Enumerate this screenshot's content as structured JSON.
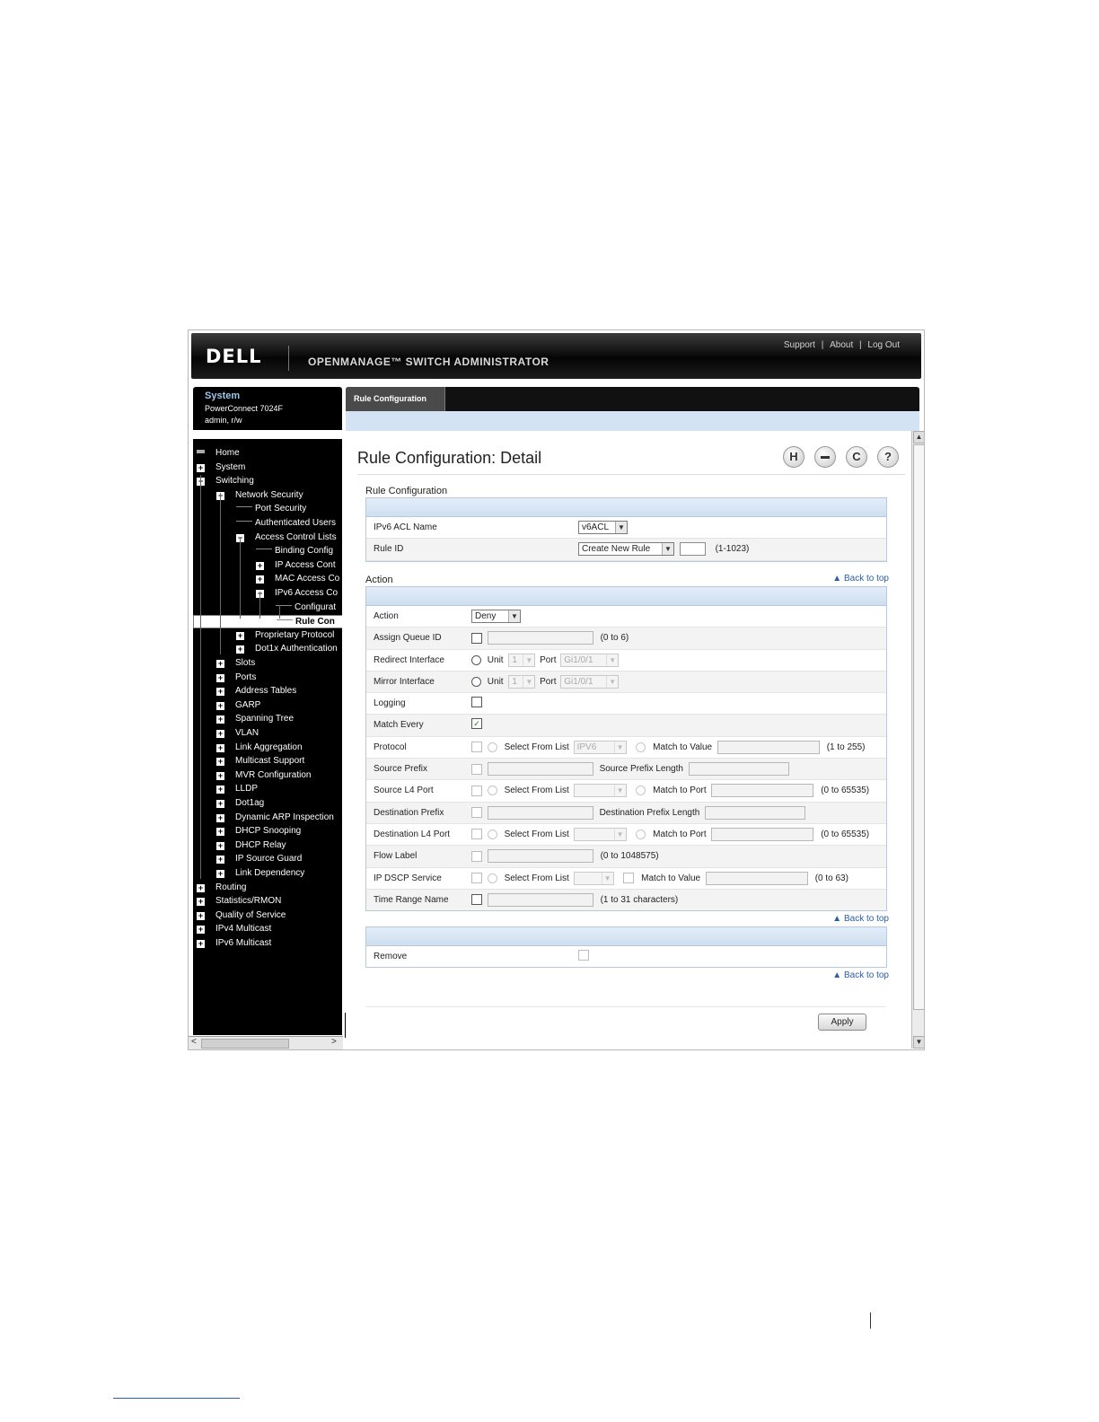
{
  "header": {
    "logo": "DELL",
    "product": "OPENMANAGE™ SWITCH ADMINISTRATOR",
    "links": [
      "Support",
      "About",
      "Log Out"
    ],
    "separator": "|"
  },
  "system_panel": {
    "title": "System",
    "model": "PowerConnect 7024F",
    "user": "admin, r/w"
  },
  "nav": {
    "items": [
      {
        "label": "Home",
        "icon": "home-icon"
      },
      {
        "label": "System",
        "icon": "expand-icon"
      },
      {
        "label": "Switching",
        "icon": "collapse-icon"
      },
      {
        "label": "Network Security",
        "icon": "collapse-icon"
      },
      {
        "label": "Port Security",
        "icon": "tree-leaf"
      },
      {
        "label": "Authenticated Users",
        "icon": "tree-leaf"
      },
      {
        "label": "Access Control Lists",
        "icon": "collapse-icon"
      },
      {
        "label": "Binding Config",
        "icon": "tree-leaf"
      },
      {
        "label": "IP Access Cont",
        "icon": "expand-icon"
      },
      {
        "label": "MAC Access Co",
        "icon": "expand-icon"
      },
      {
        "label": "IPv6 Access Co",
        "icon": "collapse-icon"
      },
      {
        "label": "Configurat",
        "icon": "tree-leaf"
      },
      {
        "label": "Rule Con",
        "icon": "tree-leaf",
        "selected": true
      },
      {
        "label": "Proprietary Protocol",
        "icon": "expand-icon"
      },
      {
        "label": "Dot1x Authentication",
        "icon": "expand-icon"
      },
      {
        "label": "Slots",
        "icon": "expand-icon"
      },
      {
        "label": "Ports",
        "icon": "expand-icon"
      },
      {
        "label": "Address Tables",
        "icon": "expand-icon"
      },
      {
        "label": "GARP",
        "icon": "expand-icon"
      },
      {
        "label": "Spanning Tree",
        "icon": "expand-icon"
      },
      {
        "label": "VLAN",
        "icon": "expand-icon"
      },
      {
        "label": "Link Aggregation",
        "icon": "expand-icon"
      },
      {
        "label": "Multicast Support",
        "icon": "expand-icon"
      },
      {
        "label": "MVR Configuration",
        "icon": "expand-icon"
      },
      {
        "label": "LLDP",
        "icon": "expand-icon"
      },
      {
        "label": "Dot1ag",
        "icon": "expand-icon"
      },
      {
        "label": "Dynamic ARP Inspection",
        "icon": "expand-icon"
      },
      {
        "label": "DHCP Snooping",
        "icon": "expand-icon"
      },
      {
        "label": "DHCP Relay",
        "icon": "expand-icon"
      },
      {
        "label": "IP Source Guard",
        "icon": "expand-icon"
      },
      {
        "label": "Link Dependency",
        "icon": "expand-icon"
      },
      {
        "label": "Routing",
        "icon": "expand-icon"
      },
      {
        "label": "Statistics/RMON",
        "icon": "expand-icon"
      },
      {
        "label": "Quality of Service",
        "icon": "expand-icon"
      },
      {
        "label": "IPv4 Multicast",
        "icon": "expand-icon"
      },
      {
        "label": "IPv6 Multicast",
        "icon": "expand-icon"
      }
    ],
    "scroll_left": "<",
    "scroll_right": ">"
  },
  "tab": {
    "label": "Rule Configuration"
  },
  "page": {
    "title": "Rule Configuration: Detail",
    "icons": [
      "save-icon",
      "print-icon",
      "refresh-icon",
      "help-icon"
    ],
    "icon_glyphs": {
      "save": "H",
      "print": "▬",
      "refresh": "C",
      "help": "?"
    }
  },
  "rule_config": {
    "section_label": "Rule Configuration",
    "acl_name_label": "IPv6 ACL Name",
    "acl_name_value": "v6ACL",
    "rule_id_label": "Rule ID",
    "rule_id_value": "Create New Rule",
    "rule_id_range": "(1-1023)"
  },
  "action": {
    "section_label": "Action",
    "back_to_top": "Back to top",
    "rows": {
      "action": {
        "label": "Action",
        "value": "Deny"
      },
      "assign_queue": {
        "label": "Assign Queue ID",
        "hint": "(0 to 6)"
      },
      "redirect": {
        "label": "Redirect Interface",
        "unit_label": "Unit",
        "unit_value": "1",
        "port_label": "Port",
        "port_value": "Gi1/0/1"
      },
      "mirror": {
        "label": "Mirror Interface",
        "unit_label": "Unit",
        "unit_value": "1",
        "port_label": "Port",
        "port_value": "Gi1/0/1"
      },
      "logging": {
        "label": "Logging"
      },
      "match_every": {
        "label": "Match Every",
        "checked": true
      },
      "protocol": {
        "label": "Protocol",
        "select_label": "Select From List",
        "select_value": "IPV6",
        "match_label": "Match to Value",
        "hint": "(1 to 255)"
      },
      "source_prefix": {
        "label": "Source Prefix",
        "length_label": "Source Prefix Length"
      },
      "source_l4": {
        "label": "Source L4 Port",
        "select_label": "Select From List",
        "match_label": "Match to Port",
        "hint": "(0 to 65535)"
      },
      "dest_prefix": {
        "label": "Destination Prefix",
        "length_label": "Destination Prefix Length"
      },
      "dest_l4": {
        "label": "Destination L4 Port",
        "select_label": "Select From List",
        "match_label": "Match to Port",
        "hint": "(0 to 65535)"
      },
      "flow_label": {
        "label": "Flow Label",
        "hint": "(0 to 1048575)"
      },
      "dscp": {
        "label": "IP DSCP Service",
        "select_label": "Select From List",
        "match_label": "Match to Value",
        "hint": "(0 to 63)"
      },
      "time_range": {
        "label": "Time Range Name",
        "hint": "(1 to 31 characters)"
      }
    }
  },
  "remove": {
    "label": "Remove",
    "back_to_top_1": "Back to top",
    "back_to_top_2": "Back to top"
  },
  "apply_label": "Apply"
}
